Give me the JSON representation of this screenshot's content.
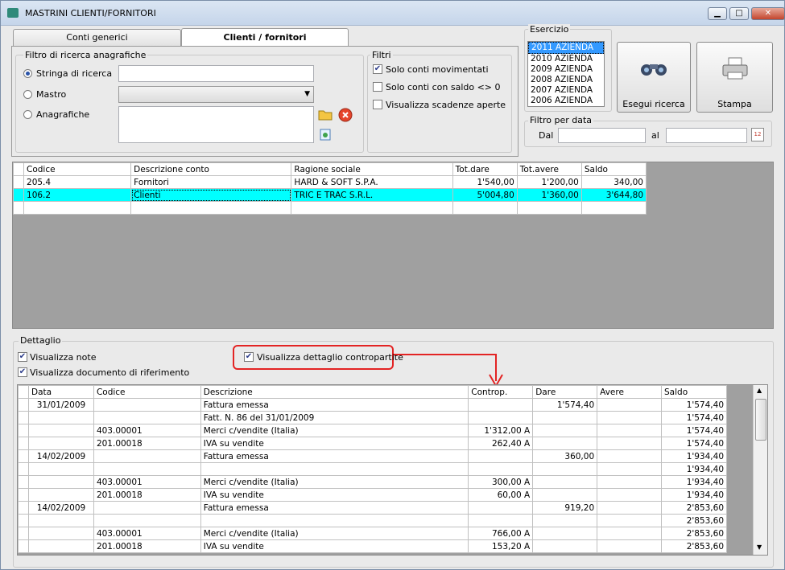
{
  "window": {
    "title": "MASTRINI CLIENTI/FORNITORI",
    "btn_min": "▁",
    "btn_max": "□",
    "btn_close": "✕"
  },
  "tabs": [
    {
      "label": "Conti generici"
    },
    {
      "label": "Clienti / fornitori"
    }
  ],
  "filtro": {
    "title": "Filtro di ricerca anagrafiche",
    "opt_stringa": "Stringa di ricerca",
    "opt_mastro": "Mastro",
    "opt_anagrafiche": "Anagrafiche",
    "stringa_value": "",
    "mastro_value": ""
  },
  "filtri": {
    "title": "Filtri",
    "chk1": "Solo conti movimentati",
    "chk2": "Solo conti con saldo <> 0",
    "chk3": "Visualizza scadenze aperte"
  },
  "esercizio": {
    "title": "Esercizio",
    "items": [
      "2011 AZIENDA",
      "2010 AZIENDA",
      "2009 AZIENDA",
      "2008 AZIENDA",
      "2007 AZIENDA",
      "2006 AZIENDA"
    ]
  },
  "buttons": {
    "esegui": "Esegui ricerca",
    "stampa": "Stampa"
  },
  "filtro_data": {
    "title": "Filtro per data",
    "dal": "Dal",
    "al": "al",
    "dal_value": "",
    "al_value": "",
    "cal_day": "12"
  },
  "conti": {
    "headers": [
      "Codice",
      "Descrizione conto",
      "Ragione sociale",
      "Tot.dare",
      "Tot.avere",
      "Saldo"
    ],
    "rows": [
      [
        "205.4",
        "Fornitori",
        "HARD & SOFT S.P.A.",
        "1'540,00",
        "1'200,00",
        "340,00"
      ],
      [
        "106.2",
        "Clienti",
        "TRIC E TRAC S.R.L.",
        "5'004,80",
        "1'360,00",
        "3'644,80"
      ],
      [
        "",
        "",
        "",
        "",
        "",
        ""
      ]
    ]
  },
  "dettaglio": {
    "title": "Dettaglio",
    "chk_note": "Visualizza note",
    "chk_doc": "Visualizza documento di riferimento",
    "chk_contro": "Visualizza dettaglio contropartite",
    "headers": [
      "Data",
      "Codice",
      "Descrizione",
      "Controp.",
      "Dare",
      "Avere",
      "Saldo"
    ],
    "rows": [
      [
        "31/01/2009",
        "",
        "Fattura emessa",
        "",
        "1'574,40",
        "",
        "1'574,40"
      ],
      [
        "",
        "",
        "Fatt. N. 86 del 31/01/2009",
        "",
        "",
        "",
        "1'574,40"
      ],
      [
        "",
        "403.00001",
        "Merci c/vendite (Italia)",
        "1'312,00 A",
        "",
        "",
        "1'574,40"
      ],
      [
        "",
        "201.00018",
        "IVA su vendite",
        "262,40 A",
        "",
        "",
        "1'574,40"
      ],
      [
        "14/02/2009",
        "",
        "Fattura emessa",
        "",
        "360,00",
        "",
        "1'934,40"
      ],
      [
        "",
        "",
        "",
        "",
        "",
        "",
        "1'934,40"
      ],
      [
        "",
        "403.00001",
        "Merci c/vendite (Italia)",
        "300,00 A",
        "",
        "",
        "1'934,40"
      ],
      [
        "",
        "201.00018",
        "IVA su vendite",
        "60,00 A",
        "",
        "",
        "1'934,40"
      ],
      [
        "14/02/2009",
        "",
        "Fattura emessa",
        "",
        "919,20",
        "",
        "2'853,60"
      ],
      [
        "",
        "",
        "",
        "",
        "",
        "",
        "2'853,60"
      ],
      [
        "",
        "403.00001",
        "Merci c/vendite (Italia)",
        "766,00 A",
        "",
        "",
        "2'853,60"
      ],
      [
        "",
        "201.00018",
        "IVA su vendite",
        "153,20 A",
        "",
        "",
        "2'853,60"
      ]
    ]
  },
  "colors": {
    "selected_row": "#00ffff",
    "list_selected": "#3399ff",
    "annotation": "#e32424"
  }
}
